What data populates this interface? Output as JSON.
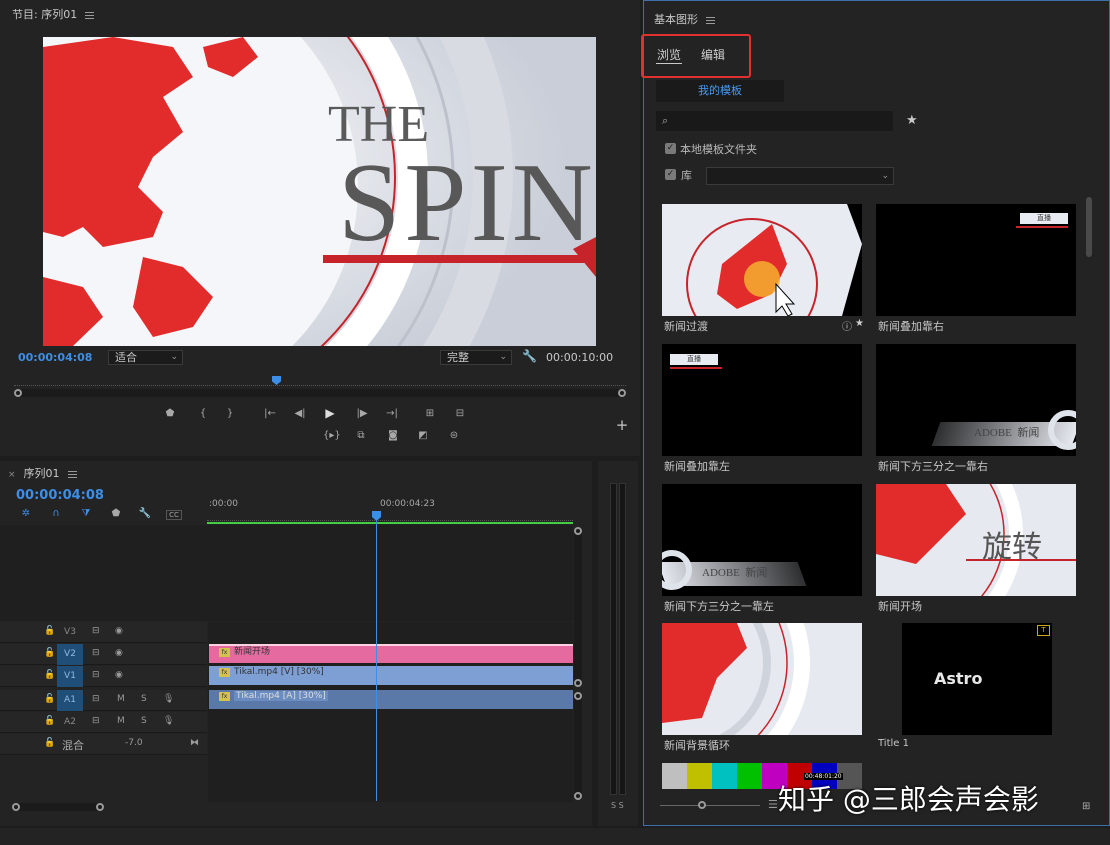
{
  "program_monitor": {
    "title": "节目: 序列01",
    "timecode_current": "00:00:04:08",
    "fit_label": "适合",
    "quality_label": "完整",
    "timecode_duration": "00:00:10:00",
    "preview_title_small": "THE",
    "preview_title_large": "SPIN"
  },
  "timeline": {
    "title": "序列01",
    "timecode": "00:00:04:08",
    "ruler_start": ":00:00",
    "ruler_mark": "00:00:04:23",
    "tracks": [
      {
        "name": "V3",
        "active": false
      },
      {
        "name": "V2",
        "active": true
      },
      {
        "name": "V1",
        "active": true
      },
      {
        "name": "A1",
        "active": true
      },
      {
        "name": "A2",
        "active": false
      }
    ],
    "mix_label": "混合",
    "mix_value": "-7.0",
    "track_m": "M",
    "track_s": "S",
    "clips": {
      "v2": "新闻开场",
      "v1": "Tikal.mp4 [V] [30%]",
      "a1": "Tikal.mp4 [A] [30%]"
    },
    "meter_labels": "S S"
  },
  "essential_graphics": {
    "title": "基本图形",
    "tab_browse": "浏览",
    "tab_edit": "编辑",
    "my_templates_button": "我的模板",
    "search_placeholder": "",
    "local_folder_label": "本地模板文件夹",
    "library_label": "库",
    "templates": [
      {
        "name": "新闻过渡"
      },
      {
        "name": "新闻叠加靠右",
        "badge": "直播"
      },
      {
        "name": "新闻叠加靠左",
        "badge": "直播"
      },
      {
        "name": "新闻下方三分之一靠右",
        "lower_text": "ADOBE  新闻"
      },
      {
        "name": "新闻下方三分之一靠左",
        "lower_text": "ADOBE  新闻"
      },
      {
        "name": "新闻开场",
        "overlay_text": "旋转"
      },
      {
        "name": "新闻背景循环"
      },
      {
        "name": "Title 1",
        "overlay_text": "Astro"
      }
    ],
    "bars_timecode": "00:48:01:20"
  },
  "watermark": "知乎 @三郎会声会影",
  "colors": {
    "accent_blue": "#3d8ee6",
    "highlight_red": "#e03030",
    "v2_clip": "#e46aa0",
    "v1_clip": "#7d9fd4",
    "a1_clip": "#5a78a8",
    "playhead": "#3d8ee6",
    "work_area": "#44cc44"
  }
}
